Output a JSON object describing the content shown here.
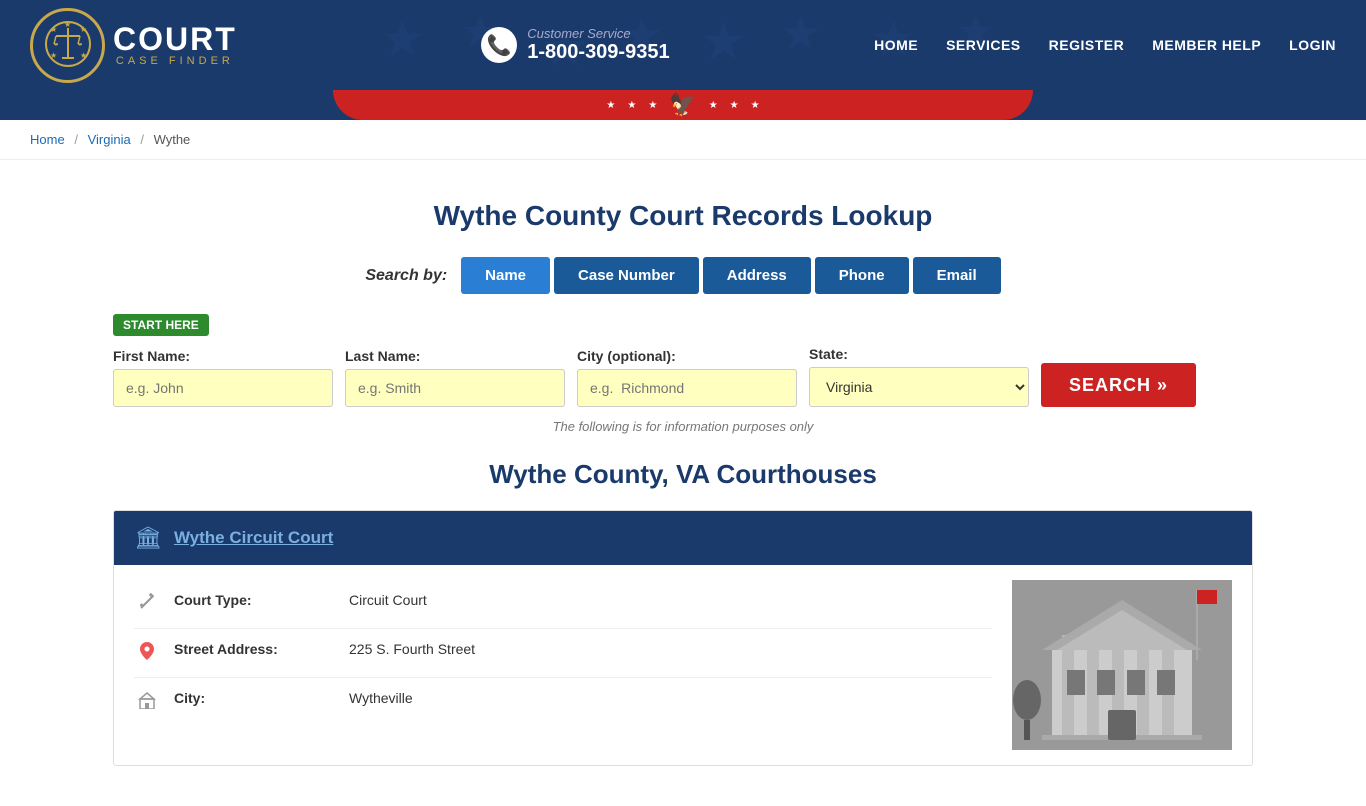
{
  "header": {
    "logo": {
      "court_text": "COURT",
      "case_finder_text": "CASE FINDER"
    },
    "customer_service": {
      "label": "Customer Service",
      "phone": "1-800-309-9351"
    },
    "nav": {
      "items": [
        {
          "label": "HOME",
          "href": "#"
        },
        {
          "label": "SERVICES",
          "href": "#"
        },
        {
          "label": "REGISTER",
          "href": "#"
        },
        {
          "label": "MEMBER HELP",
          "href": "#"
        },
        {
          "label": "LOGIN",
          "href": "#"
        }
      ]
    }
  },
  "breadcrumb": {
    "items": [
      {
        "label": "Home",
        "href": "#"
      },
      {
        "label": "Virginia",
        "href": "#"
      },
      {
        "label": "Wythe",
        "href": null
      }
    ]
  },
  "main": {
    "page_title": "Wythe County Court Records Lookup",
    "search_by_label": "Search by:",
    "search_tabs": [
      {
        "label": "Name",
        "active": true
      },
      {
        "label": "Case Number",
        "active": false
      },
      {
        "label": "Address",
        "active": false
      },
      {
        "label": "Phone",
        "active": false
      },
      {
        "label": "Email",
        "active": false
      }
    ],
    "start_here_badge": "START HERE",
    "form": {
      "first_name_label": "First Name:",
      "first_name_placeholder": "e.g. John",
      "last_name_label": "Last Name:",
      "last_name_placeholder": "e.g. Smith",
      "city_label": "City (optional):",
      "city_placeholder": "e.g.  Richmond",
      "state_label": "State:",
      "state_value": "Virginia",
      "search_button": "SEARCH »"
    },
    "info_note": "The following is for information purposes only",
    "courthouses_title": "Wythe County, VA Courthouses",
    "courthouse": {
      "name": "Wythe Circuit Court",
      "name_href": "#",
      "details": [
        {
          "icon": "gavel",
          "label": "Court Type:",
          "value": "Circuit Court"
        },
        {
          "icon": "location",
          "label": "Street Address:",
          "value": "225 S. Fourth Street"
        },
        {
          "icon": "city",
          "label": "City:",
          "value": "Wytheville"
        }
      ]
    }
  }
}
